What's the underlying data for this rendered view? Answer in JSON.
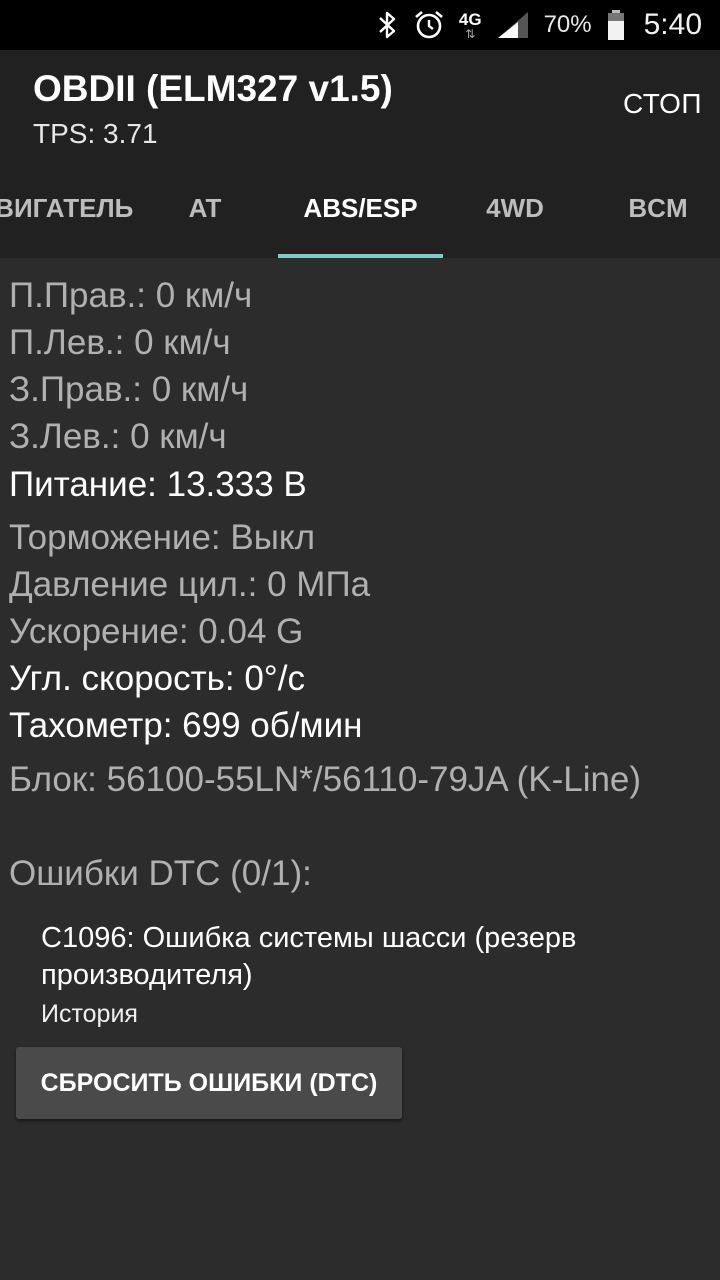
{
  "status_bar": {
    "icons": [
      "bluetooth-icon",
      "alarm-icon",
      "network-4g-icon",
      "signal-icon",
      "battery-icon"
    ],
    "network_label": "4G",
    "battery_percent": "70%",
    "time": "5:40"
  },
  "app_bar": {
    "title": "OBDII (ELM327 v1.5)",
    "subtitle": "TPS: 3.71",
    "stop_label": "СТОП"
  },
  "tabs": [
    {
      "label": "ДВИГАТЕЛЬ",
      "active": false
    },
    {
      "label": "AT",
      "active": false
    },
    {
      "label": "ABS/ESP",
      "active": true
    },
    {
      "label": "4WD",
      "active": false
    },
    {
      "label": "BCM",
      "active": false
    }
  ],
  "readings": {
    "fr_wheel": "П.Прав.: 0 км/ч",
    "fl_wheel": "П.Лев.: 0 км/ч",
    "rr_wheel": "З.Прав.: 0 км/ч",
    "rl_wheel": "З.Лев.: 0 км/ч",
    "power": "Питание: 13.333 В",
    "braking": "Торможение: Выкл",
    "pressure": "Давление цил.: 0 МПа",
    "acceleration": "Ускорение: 0.04 G",
    "yaw_rate": "Угл. скорость: 0°/с",
    "tachometer": "Тахометр: 699 об/мин",
    "module": "Блок: 56100-55LN*/56110-79JA (K-Line)",
    "dtc_header": "Ошибки DTC (0/1):"
  },
  "dtc": {
    "text": "C1096: Ошибка системы шасси (резерв производителя)",
    "status": "История"
  },
  "reset_button_label": "СБРОСИТЬ ОШИБКИ (DTC)",
  "colors": {
    "accent": "#80cbc4",
    "background": "#2c2c2c",
    "app_bar": "#212121",
    "button": "#4a4a4a"
  }
}
